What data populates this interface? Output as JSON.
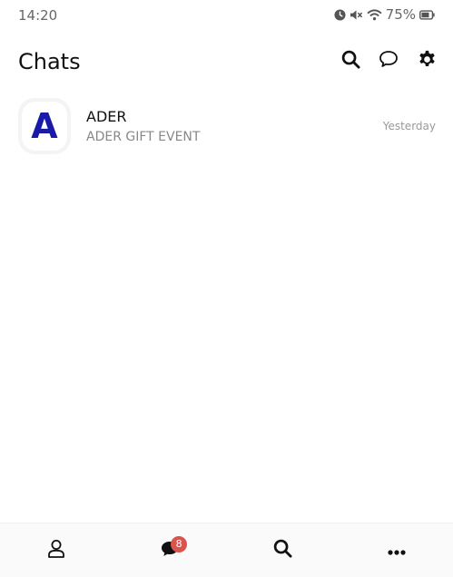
{
  "status_bar": {
    "time": "14:20",
    "battery": "75%",
    "icons": [
      "alarm-icon",
      "mute-icon",
      "wifi-icon",
      "battery-icon"
    ]
  },
  "header": {
    "title": "Chats",
    "actions": [
      "search-icon",
      "new-chat-icon",
      "gear-icon"
    ]
  },
  "chats": [
    {
      "name": "ADER",
      "preview": "ADER GIFT EVENT",
      "time": "Yesterday",
      "avatar_letter": "A",
      "avatar_color": "#1a1aa8"
    }
  ],
  "bottom_nav": {
    "items": [
      "friends-icon",
      "chats-icon",
      "search-icon",
      "more-icon"
    ],
    "chat_badge": "8",
    "badge_color": "#d9534f"
  }
}
